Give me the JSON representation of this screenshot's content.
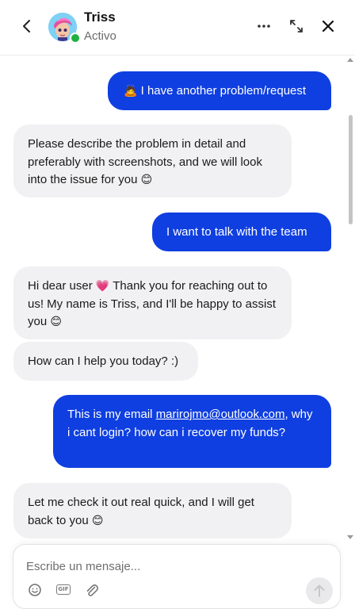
{
  "header": {
    "agent_name": "Triss",
    "agent_status": "Activo",
    "back_icon": "chevron-left-icon",
    "more_icon": "more-horizontal-icon",
    "expand_icon": "expand-icon",
    "close_icon": "close-icon",
    "presence_color": "#1fb141"
  },
  "messages": [
    {
      "sender": "user",
      "emoji": "🙇",
      "text": "I have another problem/request"
    },
    {
      "sender": "bot",
      "text": "Please describe the problem in detail and preferably with screenshots, and we will look into the issue for you",
      "emoji": "😊"
    },
    {
      "sender": "user",
      "text": "I want to talk with the team"
    },
    {
      "sender": "bot",
      "text_a": "Hi dear user",
      "emoji_a": "💗",
      "text_b": "Thank you for reaching out to us! My name is Triss, and I'll be happy to assist you",
      "emoji_b": "😊"
    },
    {
      "sender": "bot",
      "text": "How can I help you today? :)"
    },
    {
      "sender": "user",
      "text_a": "This is my email",
      "link": "marirojmo@outlook.com",
      "text_b": ", why i cant login? how can i recover my funds?"
    },
    {
      "sender": "bot",
      "text": "Let me check it out real quick, and I will get back to you",
      "emoji": "😊"
    }
  ],
  "composer": {
    "placeholder": "Escribe un mensaje...",
    "gif_label": "GIF",
    "emoji_icon": "smiley-icon",
    "attach_icon": "paperclip-icon",
    "send_icon": "arrow-up-icon"
  },
  "colors": {
    "user_bubble": "#0f3fe0",
    "bot_bubble": "#f1f1f3"
  }
}
